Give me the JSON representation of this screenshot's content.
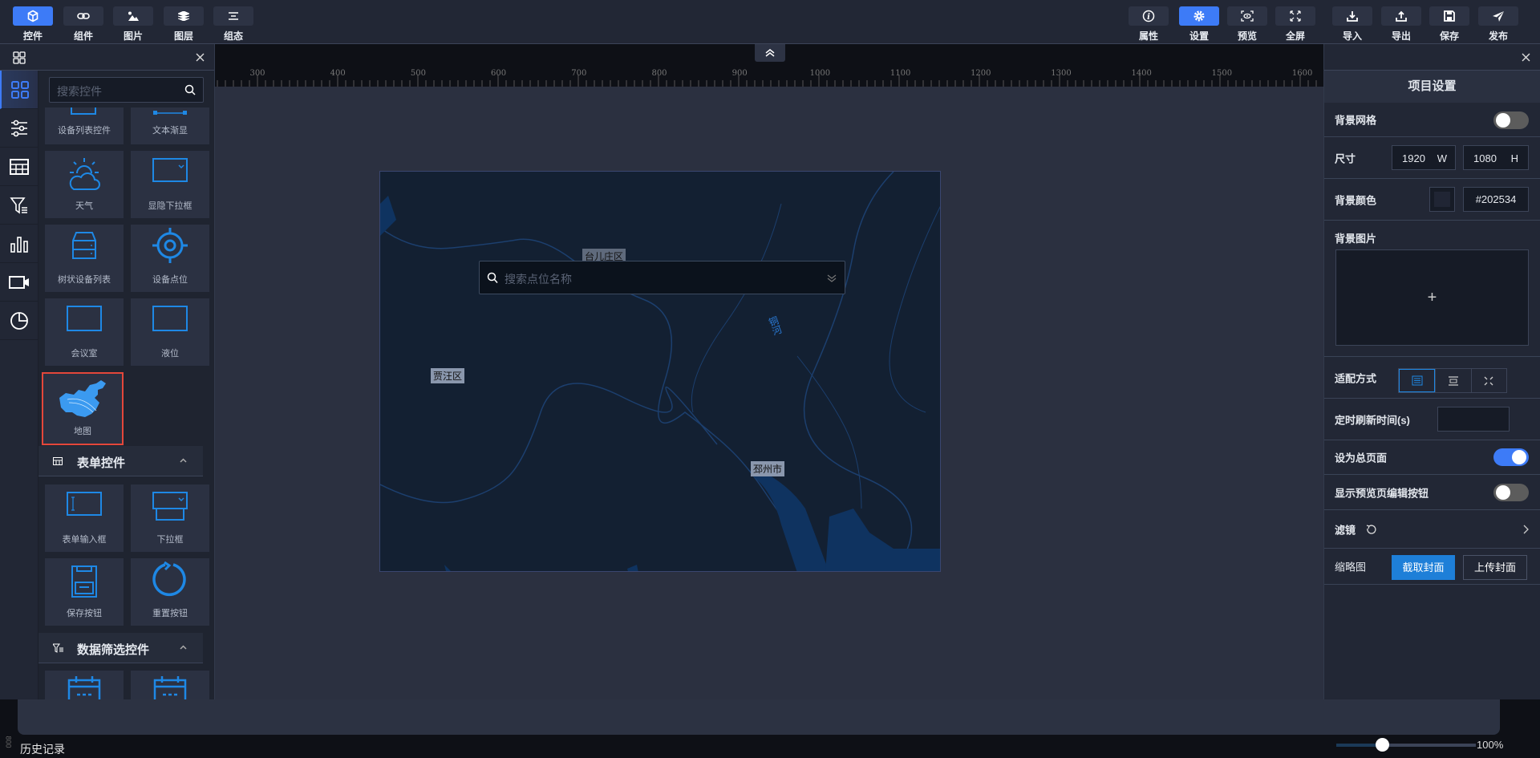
{
  "toolbar_left": [
    {
      "label": "控件",
      "icon": "cube-icon",
      "active": true
    },
    {
      "label": "组件",
      "icon": "link-icon"
    },
    {
      "label": "图片",
      "icon": "image-icon"
    },
    {
      "label": "图层",
      "icon": "layers-icon"
    },
    {
      "label": "组态",
      "icon": "align-icon"
    }
  ],
  "toolbar_right": [
    {
      "label": "属性",
      "icon": "info-icon"
    },
    {
      "label": "设置",
      "icon": "gear-icon",
      "active": true
    },
    {
      "label": "预览",
      "icon": "preview-icon"
    },
    {
      "label": "全屏",
      "icon": "fullscreen-icon"
    },
    {
      "label": "导入",
      "icon": "import-icon"
    },
    {
      "label": "导出",
      "icon": "export-icon"
    },
    {
      "label": "保存",
      "icon": "save-icon"
    },
    {
      "label": "发布",
      "icon": "send-icon"
    }
  ],
  "left_panel": {
    "search_placeholder": "搜索控件",
    "items": [
      "设备列表控件",
      "文本渐显",
      "天气",
      "显隐下拉框",
      "树状设备列表",
      "设备点位",
      "会议室",
      "液位",
      "地图"
    ],
    "sections": [
      {
        "title": "表单控件",
        "items": [
          "表单输入框",
          "下拉框",
          "保存按钮",
          "重置按钮"
        ]
      },
      {
        "title": "数据筛选控件",
        "items": []
      }
    ]
  },
  "ruler": {
    "labels": [
      "300",
      "400",
      "500",
      "600",
      "700",
      "800",
      "900",
      "1000",
      "1100",
      "1200",
      "1300",
      "1400",
      "1500",
      "1600"
    ],
    "side_label": "800"
  },
  "map": {
    "search_placeholder": "搜索点位名称",
    "labels": [
      "台儿庄区",
      "贾汪区",
      "邳州市"
    ],
    "river": "铜河"
  },
  "settings": {
    "title": "项目设置",
    "bg_grid": "背景网格",
    "bg_grid_on": false,
    "size": "尺寸",
    "width": "1920",
    "width_unit": "W",
    "height": "1080",
    "height_unit": "H",
    "bg_color": "背景颜色",
    "bg_color_value": "#202534",
    "bg_image": "背景图片",
    "add": "+",
    "fit": "适配方式",
    "refresh": "定时刷新时间(s)",
    "refresh_value": "",
    "main_page": "设为总页面",
    "main_page_on": true,
    "show_edit": "显示预览页编辑按钮",
    "show_edit_on": false,
    "filter": "滤镜",
    "thumb": "缩略图",
    "capture": "截取封面",
    "upload": "上传封面"
  },
  "bottom": {
    "history": "历史记录",
    "zoom": "100%",
    "zoom_fraction": 0.33
  },
  "colors": {
    "accent": "#3d7bf7",
    "bg": "#202534",
    "highlight": "#e4473a"
  }
}
